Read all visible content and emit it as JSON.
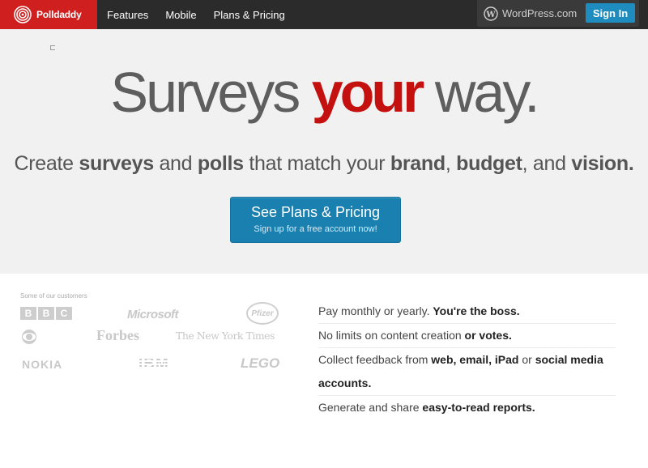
{
  "brand": {
    "logo_text": "Polldaddy",
    "red": "#cf1f1f"
  },
  "nav": {
    "items": [
      "Features",
      "Mobile",
      "Plans & Pricing"
    ]
  },
  "wordpress": {
    "label": "WordPress.com",
    "signin": "Sign In"
  },
  "hero": {
    "headline_pre": "Surveys ",
    "headline_accent": "your",
    "headline_post": " way.",
    "sub": [
      {
        "t": "Create ",
        "b": false
      },
      {
        "t": "surveys",
        "b": true
      },
      {
        "t": " and ",
        "b": false
      },
      {
        "t": "polls",
        "b": true
      },
      {
        "t": " that match your ",
        "b": false
      },
      {
        "t": "brand",
        "b": true
      },
      {
        "t": ", ",
        "b": false
      },
      {
        "t": "budget",
        "b": true
      },
      {
        "t": ", and ",
        "b": false
      },
      {
        "t": "vision.",
        "b": true
      }
    ],
    "cta_main": "See Plans & Pricing",
    "cta_sub": "Sign up for a free account now!"
  },
  "customers": {
    "title": "Some of our customers",
    "logos": [
      "BBC",
      "Microsoft",
      "Pfizer",
      "CBS",
      "Forbes",
      "The New York Times",
      "NOKIA",
      "IBM",
      "LEGO"
    ]
  },
  "features": [
    {
      "pre": "Pay monthly or yearly. ",
      "bold": "You're the boss."
    },
    {
      "pre": "No limits on content creation ",
      "bold": "or votes."
    },
    {
      "pre": "Collect feedback from ",
      "bold": "web, email, iPad",
      "mid": " or ",
      "bold2": "social media accounts."
    },
    {
      "pre": "Generate and share ",
      "bold": "easy-to-read reports."
    }
  ]
}
